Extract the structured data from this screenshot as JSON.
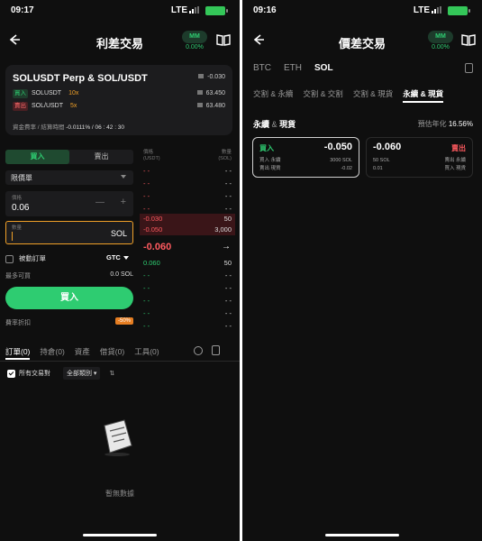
{
  "left": {
    "status": {
      "time": "09:17",
      "network": "LTE"
    },
    "title": "利差交易",
    "mm": {
      "label": "MM",
      "value": "0.00%"
    },
    "pair": {
      "title": "SOLUSDT Perp & SOL/USDT",
      "legs": [
        {
          "side": "買入",
          "symbol": "SOLUSDT",
          "leverage": "10x",
          "value": "-0.030"
        },
        {
          "side": "賣出",
          "symbol": "SOL/USDT",
          "leverage": "5x",
          "value": "63.450"
        }
      ],
      "third_value": "63.480",
      "funding_label": "資金費率 / 結算時間",
      "funding_value": "-0.0111% / 06 : 42 : 30"
    },
    "form": {
      "buy_tab": "買入",
      "sell_tab": "賣出",
      "order_type": "限價單",
      "price_label": "價格",
      "price_value": "0.06",
      "price_minus": "—",
      "price_plus": "+",
      "qty_label": "數量",
      "qty_unit": "SOL",
      "passive_label": "被動訂單",
      "tif": "GTC",
      "max_label": "最多可買",
      "max_value": "0.0 SOL",
      "buy_button": "買入",
      "fee_label": "費率折扣",
      "fee_badge": "-50%"
    },
    "orderbook": {
      "price_header_1": "價格",
      "price_header_2": "(USDT)",
      "qty_header_1": "數量",
      "qty_header_2": "(SOL)",
      "asks": [
        {
          "price": "- -",
          "qty": "- -"
        },
        {
          "price": "- -",
          "qty": "- -"
        },
        {
          "price": "- -",
          "qty": "- -"
        },
        {
          "price": "- -",
          "qty": "- -"
        },
        {
          "price": "-0.030",
          "qty": "50"
        },
        {
          "price": "-0.050",
          "qty": "3,000"
        }
      ],
      "mid_price": "-0.060",
      "mid_arrow": "→",
      "bids": [
        {
          "price": "0.060",
          "qty": "50"
        },
        {
          "price": "- -",
          "qty": "- -"
        },
        {
          "price": "- -",
          "qty": "- -"
        },
        {
          "price": "- -",
          "qty": "- -"
        },
        {
          "price": "- -",
          "qty": "- -"
        },
        {
          "price": "- -",
          "qty": "- -"
        }
      ]
    },
    "bottom": {
      "tabs": [
        "訂單(0)",
        "持倉(0)",
        "資產",
        "借貸(0)",
        "工具(0)"
      ],
      "all_pairs": "所有交易對",
      "category": "全部類別 ▾",
      "sort_icon": "⇅",
      "empty": "暫無數據"
    }
  },
  "right": {
    "status": {
      "time": "09:16",
      "network": "LTE"
    },
    "title": "價差交易",
    "mm": {
      "label": "MM",
      "value": "0.00%"
    },
    "coins": [
      "BTC",
      "ETH",
      "SOL"
    ],
    "types": [
      "交割 & 永續",
      "交割 & 交割",
      "交割 & 現貨",
      "永續 & 現貨"
    ],
    "section": {
      "title_a": "永續",
      "amp": "&",
      "title_b": "現貨",
      "annual_label": "預估年化",
      "annual_value": "16.56%"
    },
    "cards": [
      {
        "side": "買入",
        "value": "-0.050",
        "line1a": "買入 永續",
        "line1b": "3000 SOL",
        "line2a": "賣出 現貨",
        "line2b": "-0.02"
      },
      {
        "side": "賣出",
        "value": "-0.060",
        "line1a": "50 SOL",
        "line1b": "賣出 永續",
        "line2a": "0.01",
        "line2b": "買入 現貨"
      }
    ]
  },
  "colors": {
    "buy": "#2ecc71",
    "sell": "#ff5a5f",
    "accent": "#f0a028",
    "bg": "#0f0f0f"
  },
  "icons": [
    "back-arrow-icon",
    "book-icon",
    "flag-icon",
    "check-icon",
    "document-icon",
    "empty-box-icon",
    "sort-icon",
    "settings-circle-icon"
  ]
}
